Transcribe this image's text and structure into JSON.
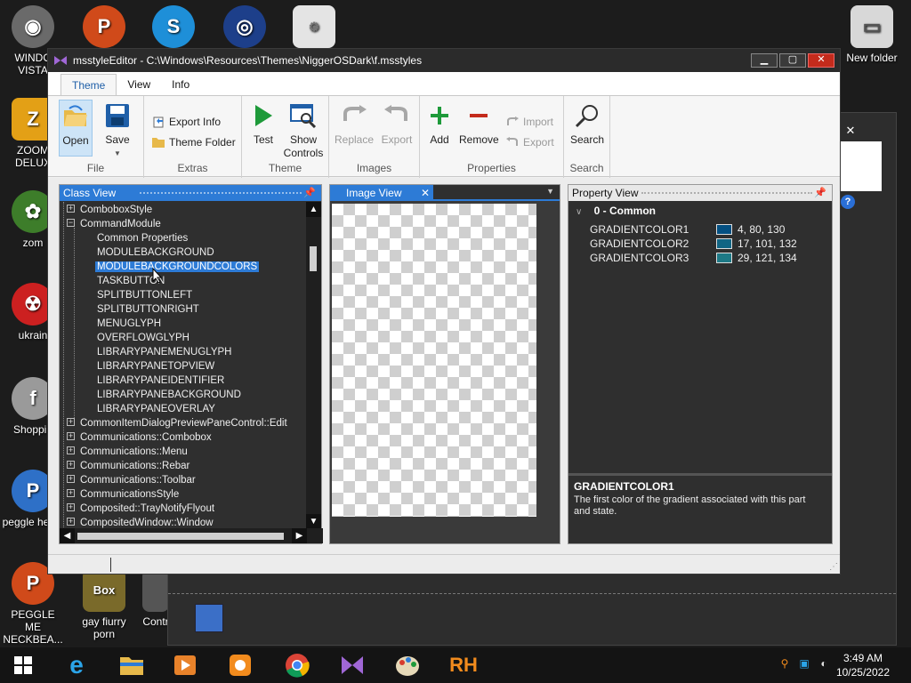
{
  "desktop": {
    "icons": [
      {
        "label": "WINDO VISTA",
        "icon": "vista-icon",
        "color": "#6a6a6a"
      },
      {
        "label": "ZOOM DELUX",
        "icon": "zoom-icon",
        "color": "#e3a016"
      },
      {
        "label": "zom",
        "icon": "flower-icon",
        "color": "#3d7d2a"
      },
      {
        "label": "ukrain",
        "icon": "radiation-icon",
        "color": "#cc2020"
      },
      {
        "label": "Shoppin",
        "icon": "flash-icon",
        "color": "#9a9a9a"
      },
      {
        "label": "peggle heggl",
        "icon": "peggle-icon",
        "color": "#2e70c7"
      },
      {
        "label": "PEGGLE ME NECKBEA...",
        "icon": "peggle-icon",
        "color": "#d04a1a"
      },
      {
        "label": "gay fiurry porn",
        "icon": "box-icon",
        "color": "#7a6a2a"
      },
      {
        "label": "Contr",
        "icon": "control-icon",
        "color": "#555"
      },
      {
        "label": "New folder",
        "icon": "folder-icon",
        "color": "#d8d8d8"
      }
    ]
  },
  "window": {
    "title": "msstyleEditor - C:\\Windows\\Resources\\Themes\\NiggerOSDark\\f.msstyles",
    "minimize": "▁",
    "maximize": "▢",
    "close": "✕"
  },
  "tabs": [
    {
      "label": "Theme",
      "active": true
    },
    {
      "label": "View",
      "active": false
    },
    {
      "label": "Info",
      "active": false
    }
  ],
  "ribbon": {
    "file": {
      "label": "File",
      "open": "Open",
      "save": "Save"
    },
    "extras": {
      "label": "Extras",
      "export_info": "Export Info",
      "theme_folder": "Theme Folder"
    },
    "theme": {
      "label": "Theme",
      "test": "Test",
      "show_controls": "Show Controls"
    },
    "images": {
      "label": "Images",
      "replace": "Replace",
      "export": "Export"
    },
    "properties": {
      "label": "Properties",
      "add": "Add",
      "remove": "Remove",
      "import": "Import",
      "export": "Export"
    },
    "search": {
      "label": "Search",
      "search": "Search"
    }
  },
  "class_view": {
    "title": "Class View",
    "items": [
      {
        "text": "ComboboxStyle",
        "level": 0,
        "expander": "+"
      },
      {
        "text": "CommandModule",
        "level": 0,
        "expander": "−"
      },
      {
        "text": "Common Properties",
        "level": 1
      },
      {
        "text": "MODULEBACKGROUND",
        "level": 1
      },
      {
        "text": "MODULEBACKGROUNDCOLORS",
        "level": 1,
        "selected": true
      },
      {
        "text": "TASKBUTTON",
        "level": 1
      },
      {
        "text": "SPLITBUTTONLEFT",
        "level": 1
      },
      {
        "text": "SPLITBUTTONRIGHT",
        "level": 1
      },
      {
        "text": "MENUGLYPH",
        "level": 1
      },
      {
        "text": "OVERFLOWGLYPH",
        "level": 1
      },
      {
        "text": "LIBRARYPANEMENUGLYPH",
        "level": 1
      },
      {
        "text": "LIBRARYPANETOPVIEW",
        "level": 1
      },
      {
        "text": "LIBRARYPANEIDENTIFIER",
        "level": 1
      },
      {
        "text": "LIBRARYPANEBACKGROUND",
        "level": 1
      },
      {
        "text": "LIBRARYPANEOVERLAY",
        "level": 1
      },
      {
        "text": "CommonItemDialogPreviewPaneControl::Edit",
        "level": 0,
        "expander": "+"
      },
      {
        "text": "Communications::Combobox",
        "level": 0,
        "expander": "+"
      },
      {
        "text": "Communications::Menu",
        "level": 0,
        "expander": "+"
      },
      {
        "text": "Communications::Rebar",
        "level": 0,
        "expander": "+"
      },
      {
        "text": "Communications::Toolbar",
        "level": 0,
        "expander": "+"
      },
      {
        "text": "CommunicationsStyle",
        "level": 0,
        "expander": "+"
      },
      {
        "text": "Composited::TrayNotifyFlyout",
        "level": 0,
        "expander": "+"
      },
      {
        "text": "CompositedWindow::Window",
        "level": 0,
        "expander": "+"
      }
    ]
  },
  "image_view": {
    "title": "Image View",
    "close": "✕"
  },
  "property_view": {
    "title": "Property View",
    "category": "0 - Common",
    "properties": [
      {
        "name": "GRADIENTCOLOR1",
        "value": "4, 80, 130",
        "color": "#045082"
      },
      {
        "name": "GRADIENTCOLOR2",
        "value": "17, 101, 132",
        "color": "#116584"
      },
      {
        "name": "GRADIENTCOLOR3",
        "value": "29, 121, 134",
        "color": "#1d7986"
      }
    ],
    "description_title": "GRADIENTCOLOR1",
    "description": "The first color of the gradient associated with this part and state."
  },
  "taskbar": {
    "items": [
      "windows-start-icon",
      "internet-explorer-icon",
      "file-explorer-icon",
      "media-player-icon",
      "uc-browser-icon",
      "chrome-icon",
      "msstyle-editor-icon",
      "paint-icon",
      "rh-icon"
    ],
    "time": "3:49 AM",
    "date": "10/25/2022"
  },
  "colors": {
    "accent": "#2d7bd6",
    "titlebar": "#2b2b2b",
    "close": "#c42b1c"
  }
}
